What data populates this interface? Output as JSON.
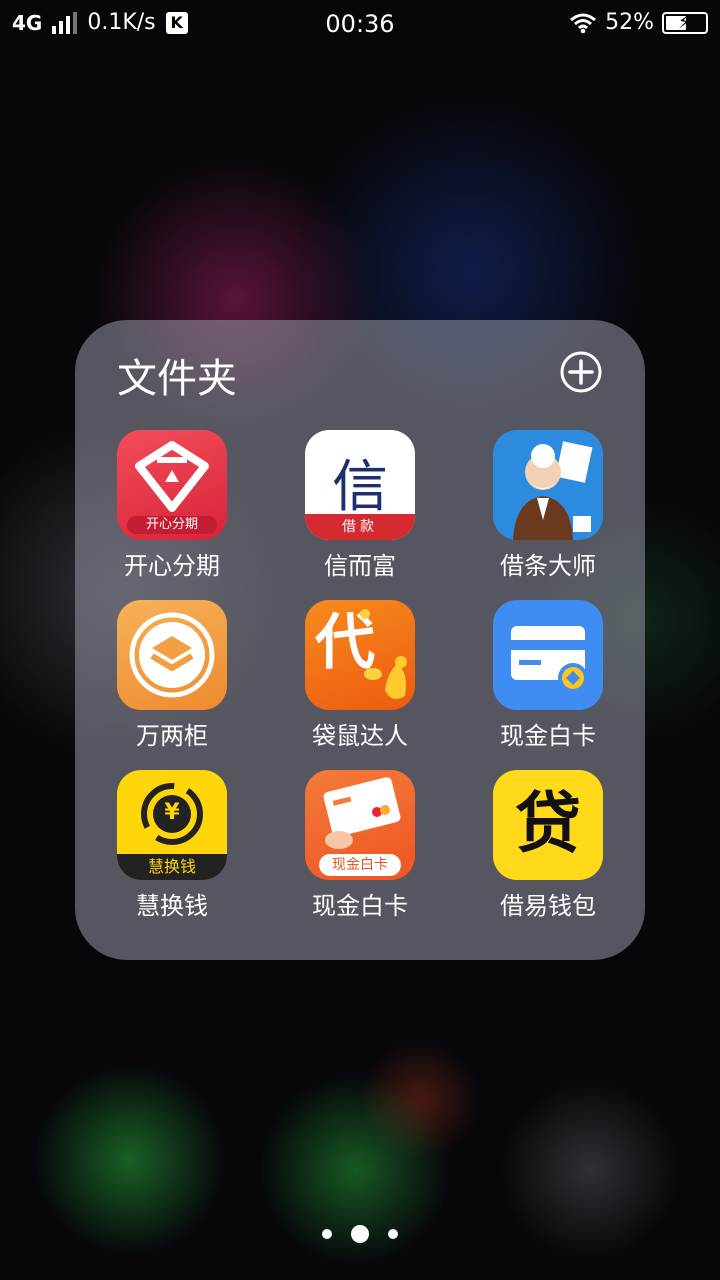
{
  "status_bar": {
    "network": "4G",
    "speed": "0.1K/s",
    "notification_badge": "K",
    "time": "00:36",
    "battery_percent": "52%",
    "battery_level": 0.52
  },
  "folder": {
    "title": "文件夹",
    "add_icon": "plus-circle-icon",
    "apps": [
      {
        "label": "开心分期",
        "icon": "kaixin-fenqi-icon",
        "badge_text": "开心分期",
        "color": "#e8404d"
      },
      {
        "label": "信而富",
        "icon": "xinerfu-icon",
        "badge_text": "借款",
        "glyph": "信",
        "color": "#d52a2f"
      },
      {
        "label": "借条大师",
        "icon": "jietiao-dashi-icon",
        "color": "#2c8bde"
      },
      {
        "label": "万两柜",
        "icon": "wanlianggui-icon",
        "color": "#f2a041"
      },
      {
        "label": "袋鼠达人",
        "icon": "daishu-daren-icon",
        "glyph": "代",
        "color": "#f06a12"
      },
      {
        "label": "现金白卡",
        "icon": "card-icon",
        "color": "#3f8cf3"
      },
      {
        "label": "慧换钱",
        "icon": "huihuanqian-icon",
        "badge_text": "慧换钱",
        "glyph": "¥",
        "color": "#ffd60a"
      },
      {
        "label": "现金白卡",
        "icon": "xianjin-baika-icon",
        "badge_text": "现金白卡",
        "color": "#f2622a"
      },
      {
        "label": "借易钱包",
        "icon": "jieyi-qianbao-icon",
        "glyph": "贷",
        "color": "#ffd91a"
      }
    ],
    "page_count": 3,
    "current_page": 2
  }
}
